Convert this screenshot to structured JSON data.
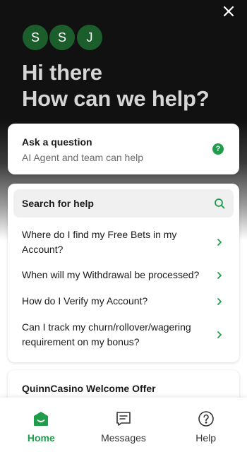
{
  "header": {
    "avatars": [
      "S",
      "S",
      "J"
    ],
    "greeting_line1": "Hi there",
    "greeting_line2": "How can we help?"
  },
  "ask_card": {
    "title": "Ask a question",
    "subtitle": "AI Agent and team can help",
    "icon": "question-icon"
  },
  "help_card": {
    "search_label": "Search for help",
    "faqs": [
      "Where do I find my Free Bets in my Account?",
      "When will my Withdrawal be processed?",
      "How do I Verify my Account?",
      "Can I track my churn/rollover/wagering requirement on my bonus?"
    ]
  },
  "offer_card": {
    "title": "QuinnCasino Welcome Offer"
  },
  "nav": {
    "home": "Home",
    "messages": "Messages",
    "help": "Help"
  },
  "colors": {
    "accent": "#1f9d4a",
    "avatar": "#1b5e2c",
    "hero": "#111111"
  }
}
